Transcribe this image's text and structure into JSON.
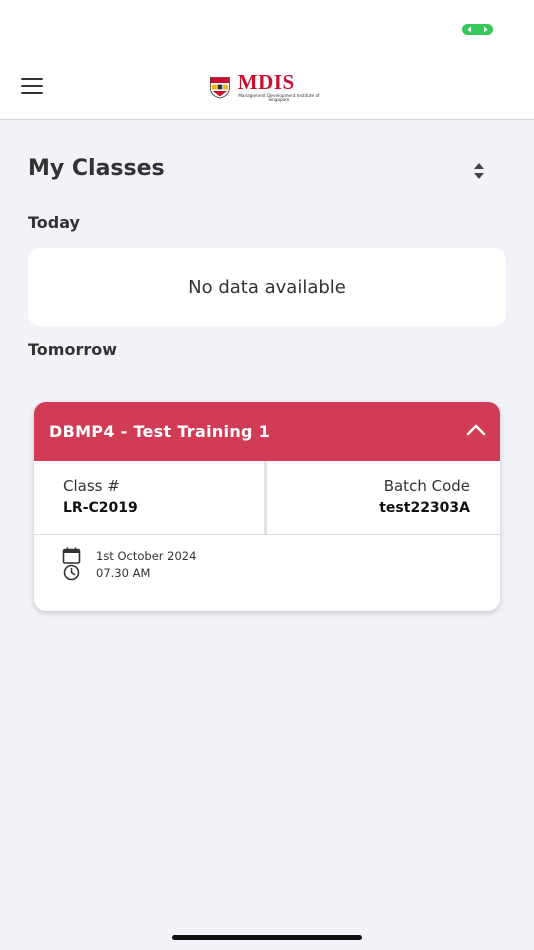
{
  "header": {
    "logo": {
      "main_text": "MDIS",
      "sub_text": "Management Development Institute of Singapore",
      "brand_color": "#c8102e"
    },
    "menu_icon": "hamburger-menu-icon"
  },
  "page": {
    "title": "My Classes",
    "sort_icon": "sort-icon"
  },
  "sections": {
    "today": {
      "label": "Today",
      "empty_message": "No data available"
    },
    "tomorrow": {
      "label": "Tomorrow"
    }
  },
  "class_card": {
    "title": "DBMP4 - Test Training 1",
    "header_color": "#d13b55",
    "expanded": true,
    "class_label": "Class #",
    "class_value": "LR-C2019",
    "batch_label": "Batch Code",
    "batch_value": "test22303A",
    "date": "1st October 2024",
    "time": "07.30 AM"
  },
  "status_bar": {
    "indicator_color": "#34c759"
  }
}
